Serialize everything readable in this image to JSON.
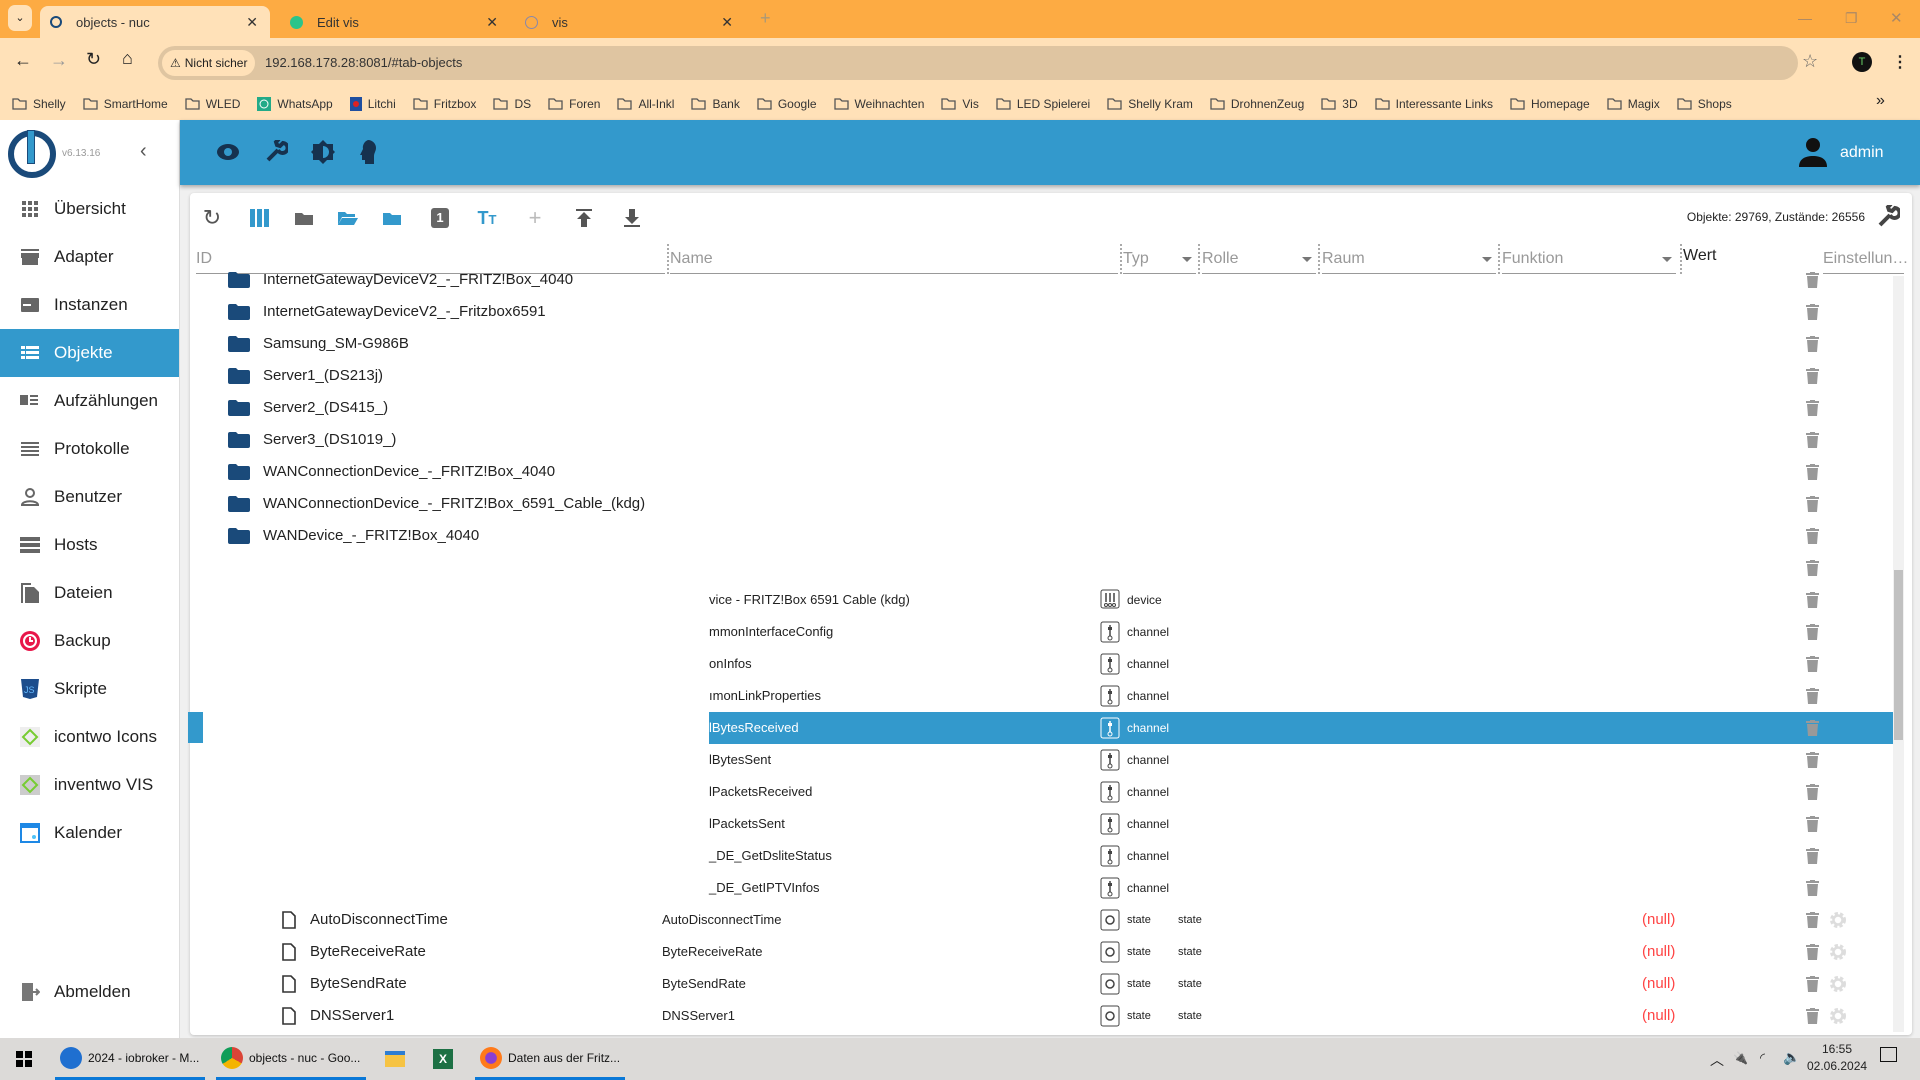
{
  "browser": {
    "tabs": [
      {
        "label": "objects - nuc",
        "active": true
      },
      {
        "label": "Edit vis"
      },
      {
        "label": "vis"
      }
    ],
    "not_secure": "Nicht sicher",
    "url": "192.168.178.28:8081/#tab-objects",
    "bookmarks": [
      "Shelly",
      "SmartHome",
      "WLED",
      "WhatsApp",
      "Litchi",
      "Fritzbox",
      "DS",
      "Foren",
      "All-Inkl",
      "Bank",
      "Google",
      "Weihnachten",
      "Vis",
      "LED Spielerei",
      "Shelly Kram",
      "DrohnenZeug",
      "3D",
      "Interessante Links",
      "Homepage",
      "Magix",
      "Shops"
    ],
    "more": "»",
    "profile_initial": "T"
  },
  "app": {
    "version": "v6.13.16",
    "user": "admin",
    "accent": "#3399cc",
    "sidebar": [
      {
        "label": "Übersicht",
        "icon": "grid-icon"
      },
      {
        "label": "Adapter",
        "icon": "store-icon"
      },
      {
        "label": "Instanzen",
        "icon": "instances-icon"
      },
      {
        "label": "Objekte",
        "icon": "list-icon",
        "active": true
      },
      {
        "label": "Aufzählungen",
        "icon": "enum-icon"
      },
      {
        "label": "Protokolle",
        "icon": "log-icon"
      },
      {
        "label": "Benutzer",
        "icon": "user-icon"
      },
      {
        "label": "Hosts",
        "icon": "hosts-icon"
      },
      {
        "label": "Dateien",
        "icon": "files-icon"
      },
      {
        "label": "Backup",
        "icon": "backup-icon"
      },
      {
        "label": "Skripte",
        "icon": "js-icon"
      },
      {
        "label": "icontwo Icons",
        "icon": "icontwo-icon"
      },
      {
        "label": "inventwo VIS",
        "icon": "inventwo-icon"
      },
      {
        "label": "Kalender",
        "icon": "calendar-icon"
      }
    ],
    "logout": "Abmelden",
    "counts": "Objekte: 29769, Zustände: 26556",
    "columns": {
      "id": "ID",
      "name": "Name",
      "type": "Typ",
      "role": "Rolle",
      "room": "Raum",
      "function": "Funktion",
      "value": "Wert",
      "settings": "Einstellun…"
    },
    "rows": [
      {
        "kind": "folder",
        "id": "InternetGatewayDeviceV2_-_FRITZ!Box_4040"
      },
      {
        "kind": "folder",
        "id": "InternetGatewayDeviceV2_-_Fritzbox6591"
      },
      {
        "kind": "folder",
        "id": "Samsung_SM-G986B"
      },
      {
        "kind": "folder",
        "id": "Server1_(DS213j)"
      },
      {
        "kind": "folder",
        "id": "Server2_(DS415_)"
      },
      {
        "kind": "folder",
        "id": "Server3_(DS1019_)"
      },
      {
        "kind": "folder",
        "id": "WANConnectionDevice_-_FRITZ!Box_4040"
      },
      {
        "kind": "folder",
        "id": "WANConnectionDevice_-_FRITZ!Box_6591_Cable_(kdg)"
      },
      {
        "kind": "folder",
        "id": "WANDevice_-_FRITZ!Box_4040"
      },
      {
        "kind": "empty"
      },
      {
        "kind": "partial",
        "name": "vice - FRITZ!Box 6591 Cable (kdg)",
        "type": "device"
      },
      {
        "kind": "partial",
        "name": "mmonInterfaceConfig",
        "type": "channel"
      },
      {
        "kind": "partial",
        "name": "onInfos",
        "type": "channel"
      },
      {
        "kind": "partial",
        "name": "ımonLinkProperties",
        "type": "channel"
      },
      {
        "kind": "partial",
        "name": "lBytesReceived",
        "type": "channel",
        "selected": true
      },
      {
        "kind": "partial",
        "name": "lBytesSent",
        "type": "channel"
      },
      {
        "kind": "partial",
        "name": "lPacketsReceived",
        "type": "channel"
      },
      {
        "kind": "partial",
        "name": "lPacketsSent",
        "type": "channel"
      },
      {
        "kind": "partial",
        "name": "_DE_GetDsliteStatus",
        "type": "channel"
      },
      {
        "kind": "partial",
        "name": "_DE_GetIPTVInfos",
        "type": "channel"
      },
      {
        "kind": "state",
        "id": "AutoDisconnectTime",
        "name": "AutoDisconnectTime",
        "type": "state",
        "role": "state",
        "value": "(null)"
      },
      {
        "kind": "state",
        "id": "ByteReceiveRate",
        "name": "ByteReceiveRate",
        "type": "state",
        "role": "state",
        "value": "(null)"
      },
      {
        "kind": "state",
        "id": "ByteSendRate",
        "name": "ByteSendRate",
        "type": "state",
        "role": "state",
        "value": "(null)"
      },
      {
        "kind": "state",
        "id": "DNSServer1",
        "name": "DNSServer1",
        "type": "state",
        "role": "state",
        "value": "(null)"
      }
    ],
    "null_color": "#ff4444"
  },
  "taskbar": {
    "items": [
      {
        "label": "2024 - iobroker - M...",
        "icon": "thunderbird-icon"
      },
      {
        "label": "objects - nuc - Goo...",
        "icon": "chrome-icon"
      },
      {
        "label": "",
        "icon": "explorer-icon"
      },
      {
        "label": "",
        "icon": "excel-icon"
      },
      {
        "label": "Daten aus der Fritz...",
        "icon": "firefox-icon"
      }
    ],
    "time": "16:55",
    "date": "02.06.2024"
  }
}
